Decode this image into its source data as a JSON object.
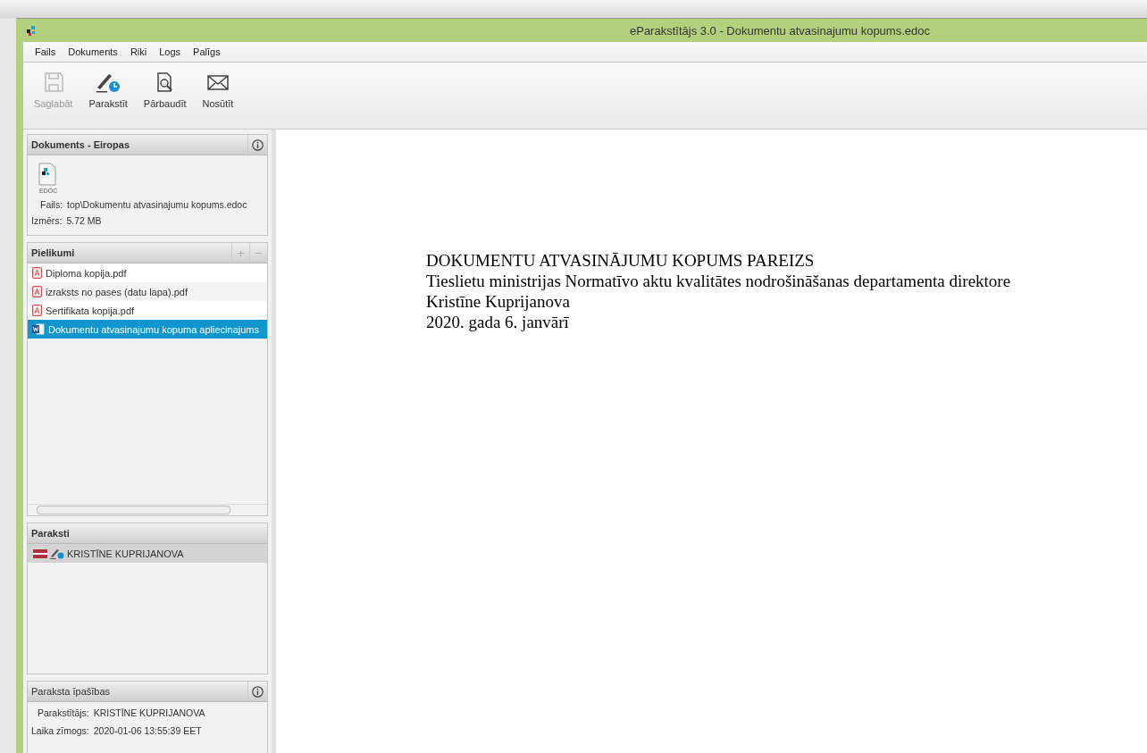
{
  "window": {
    "title": "eParakstītājs 3.0 - Dokumentu atvasinajumu kopums.edoc"
  },
  "menu": [
    "Fails",
    "Dokuments",
    "Riki",
    "Logs",
    "Palīgs"
  ],
  "toolbar": [
    {
      "kind": "save",
      "label": "Saglabāt",
      "disabled": true
    },
    {
      "kind": "sign",
      "label": "Parakstīt",
      "disabled": false
    },
    {
      "kind": "verify",
      "label": "Pārbaudīt",
      "disabled": false
    },
    {
      "kind": "send",
      "label": "Nosūtīt",
      "disabled": false
    }
  ],
  "document_panel": {
    "title": "Dokuments - Eiropas",
    "file_label": "Fails:",
    "file_value": "top\\Dokumentu atvasinajumu kopums.edoc",
    "size_label": "Izmērs:",
    "size_value": "5.72 MB",
    "icon_label": "EDOC"
  },
  "attachments": {
    "title": "Pielikumi",
    "add": "+",
    "remove": "−",
    "items": [
      {
        "kind": "pdf",
        "name": "Diploma kopija.pdf",
        "selected": false
      },
      {
        "kind": "pdf",
        "name": "izraksts no pases (datu lapa).pdf",
        "selected": false
      },
      {
        "kind": "pdf",
        "name": "Sertifikata kopija.pdf",
        "selected": false
      },
      {
        "kind": "word",
        "name": "Dokumentu atvasinajumu kopuma apliecinajums",
        "selected": true
      }
    ]
  },
  "signatures": {
    "title": "Paraksti",
    "items": [
      {
        "name": "KRISTĪNE KUPRIJANOVA",
        "selected": true
      }
    ]
  },
  "signature_properties": {
    "title": "Paraksta īpašības",
    "rows": [
      {
        "label": "Parakstītājs:",
        "value": "KRISTĪNE KUPRIJANOVA"
      },
      {
        "label": "Laika zīmogs:",
        "value": "2020-01-06 13:55:39 EET"
      }
    ]
  },
  "document_lines": [
    "DOKUMENTU ATVASINĀJUMU KOPUMS PAREIZS",
    "Tieslietu ministrijas Normatīvo aktu kvalitātes nodrošināšanas departamenta direktore",
    "Kristīne Kuprijanova",
    "2020. gada 6. janvārī"
  ]
}
